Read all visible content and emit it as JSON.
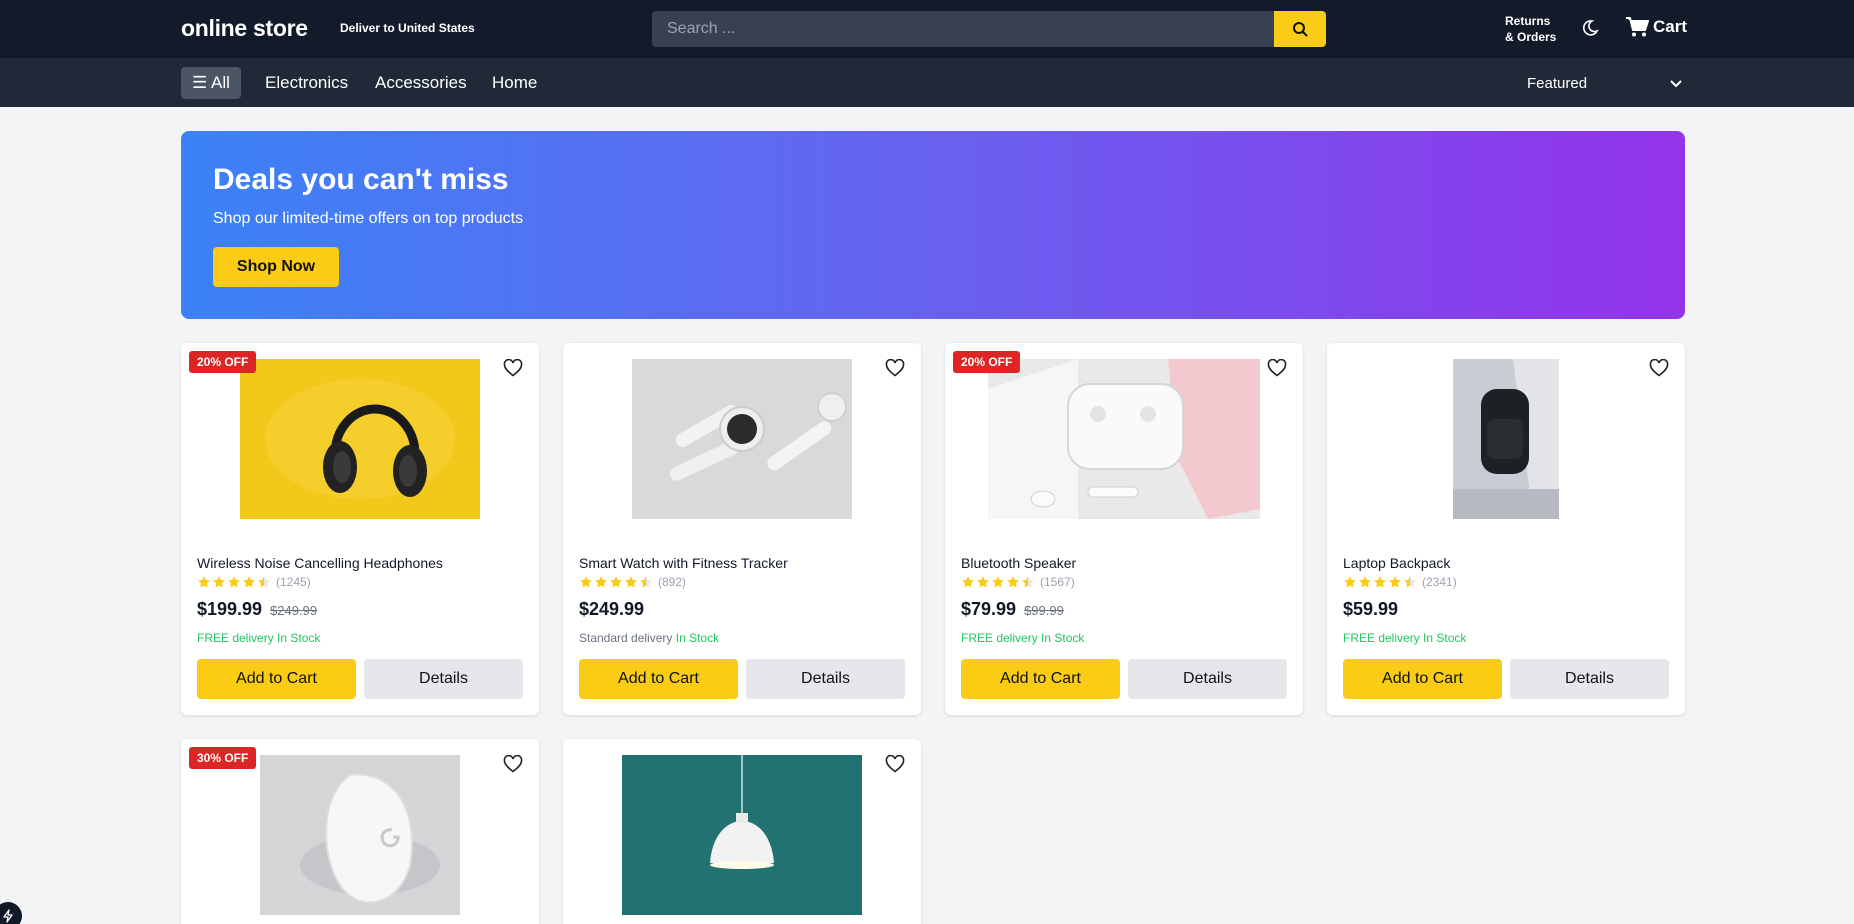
{
  "header": {
    "logo": "online store",
    "deliver_prefix": "Deliver to",
    "deliver_country": "United States",
    "search_placeholder": "Search ...",
    "returns_line1": "Returns",
    "returns_line2": "& Orders",
    "cart_label": "Cart"
  },
  "nav": {
    "all_label": "☰ All",
    "links": [
      "Electronics",
      "Accessories",
      "Home"
    ],
    "sort_selected": "Featured"
  },
  "banner": {
    "title": "Deals you can't miss",
    "subtitle": "Shop our limited-time offers on top products",
    "button": "Shop Now"
  },
  "products": [
    {
      "badge": "20% OFF",
      "name": "Wireless Noise Cancelling Headphones",
      "rating": 4.5,
      "reviews": "(1245)",
      "price": "$199.99",
      "old_price": "$249.99",
      "delivery": "FREE delivery",
      "stock": "In Stock",
      "add_label": "Add to Cart",
      "details_label": "Details"
    },
    {
      "badge": "",
      "name": "Smart Watch with Fitness Tracker",
      "rating": 4.5,
      "reviews": "(892)",
      "price": "$249.99",
      "old_price": "",
      "delivery": "Standard delivery",
      "stock": "In Stock",
      "add_label": "Add to Cart",
      "details_label": "Details"
    },
    {
      "badge": "20% OFF",
      "name": "Bluetooth Speaker",
      "rating": 4.5,
      "reviews": "(1567)",
      "price": "$79.99",
      "old_price": "$99.99",
      "delivery": "FREE delivery",
      "stock": "In Stock",
      "add_label": "Add to Cart",
      "details_label": "Details"
    },
    {
      "badge": "",
      "name": "Laptop Backpack",
      "rating": 4.5,
      "reviews": "(2341)",
      "price": "$59.99",
      "old_price": "",
      "delivery": "FREE delivery",
      "stock": "In Stock",
      "add_label": "Add to Cart",
      "details_label": "Details"
    },
    {
      "badge": "30% OFF"
    },
    {
      "badge": ""
    }
  ],
  "colors": {
    "header_bg": "#131a2a",
    "nav_bg": "#1f2937",
    "accent": "#facc15",
    "badge": "#dc2626",
    "in_stock": "#22c55e"
  }
}
